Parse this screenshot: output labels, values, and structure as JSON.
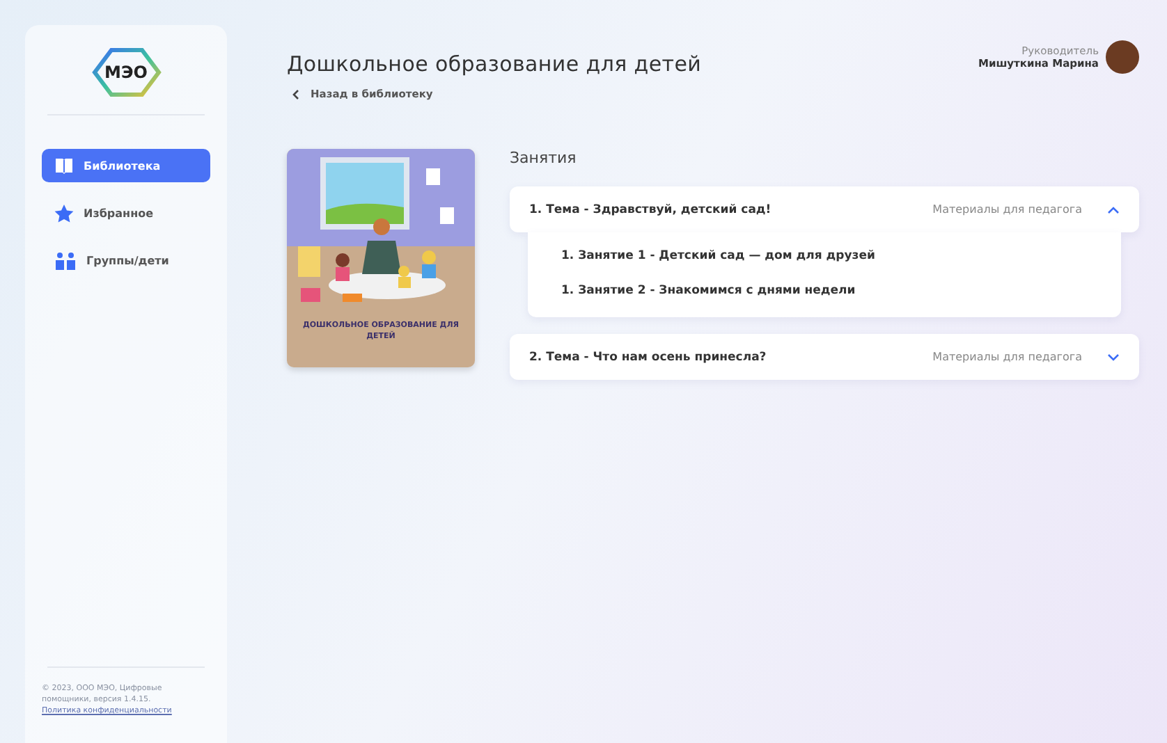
{
  "sidebar": {
    "logo": "МЭО",
    "items": [
      {
        "label": "Библиотека",
        "kind": "book",
        "selected": true
      },
      {
        "label": "Избранное",
        "kind": "star",
        "selected": false
      },
      {
        "label": "Группы/дети",
        "kind": "people",
        "selected": false
      }
    ],
    "footer": {
      "text": "© 2023, ООО МЭО, Цифровые помощники, версия 1.4.15.",
      "link": "Политика конфиденциальности"
    }
  },
  "header": {
    "title": "Дошкольное образование для детей",
    "back": "Назад в библиотеку",
    "user": {
      "role": "Руководитель",
      "name": "Мишуткина Марина"
    }
  },
  "cover": {
    "caption": "ДОШКОЛЬНОЕ ОБРАЗОВАНИЕ ДЛЯ ДЕТЕЙ"
  },
  "section_title": "Занятия",
  "topics": [
    {
      "title": "1. Тема - Здравствуй, детский сад!",
      "materials": "Материалы для педагога",
      "expanded": true,
      "lessons": [
        "1. Занятие 1 - Детский сад — дом для друзей",
        "1. Занятие 2 - Знакомимся с днями недели"
      ]
    },
    {
      "title": "2. Тема - Что нам осень принесла?",
      "materials": "Материалы для педагога",
      "expanded": false
    }
  ]
}
